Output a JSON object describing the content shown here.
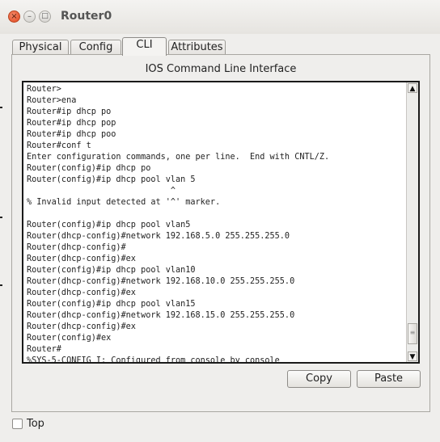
{
  "window": {
    "title": "Router0",
    "close_glyph": "×",
    "min_glyph": "–",
    "max_glyph": "□"
  },
  "tabs": [
    {
      "label": "Physical",
      "active": false
    },
    {
      "label": "Config",
      "active": false
    },
    {
      "label": "CLI",
      "active": true
    },
    {
      "label": "Attributes",
      "active": false
    }
  ],
  "panel": {
    "title": "IOS Command Line Interface"
  },
  "terminal": {
    "lines": [
      "Router>",
      "Router>ena",
      "Router#ip dhcp po",
      "Router#ip dhcp pop",
      "Router#ip dhcp poo",
      "Router#conf t",
      "Enter configuration commands, one per line.  End with CNTL/Z.",
      "Router(config)#ip dhcp po",
      "Router(config)#ip dhcp pool vlan 5",
      "                             ^",
      "% Invalid input detected at '^' marker.",
      "",
      "Router(config)#ip dhcp pool vlan5",
      "Router(dhcp-config)#network 192.168.5.0 255.255.255.0",
      "Router(dhcp-config)#",
      "Router(dhcp-config)#ex",
      "Router(config)#ip dhcp pool vlan10",
      "Router(dhcp-config)#network 192.168.10.0 255.255.255.0",
      "Router(dhcp-config)#ex",
      "Router(config)#ip dhcp pool vlan15",
      "Router(dhcp-config)#network 192.168.15.0 255.255.255.0",
      "Router(dhcp-config)#ex",
      "Router(config)#ex",
      "Router#",
      "%SYS-5-CONFIG_I: Configured from console by console"
    ],
    "scroll_up_glyph": "▲",
    "scroll_down_glyph": "▼",
    "thumb_grip": "≡"
  },
  "buttons": {
    "copy": "Copy",
    "paste": "Paste"
  },
  "footer": {
    "top_checkbox_label": "Top",
    "top_checked": false
  }
}
